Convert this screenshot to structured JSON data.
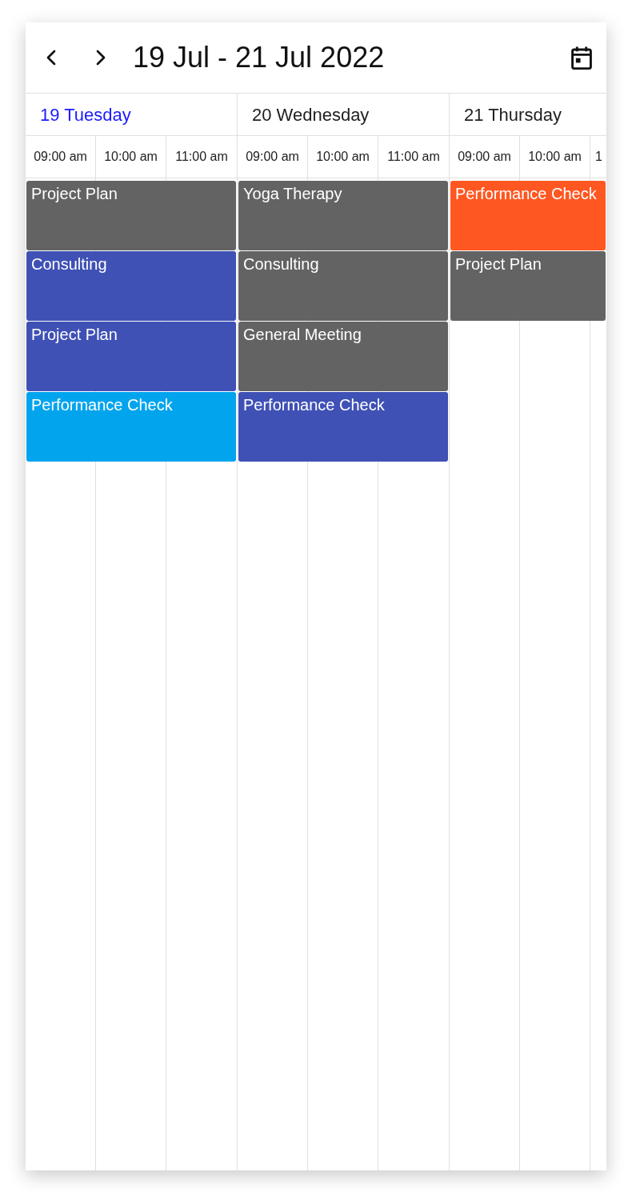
{
  "toolbar": {
    "title": "19 Jul - 21 Jul 2022"
  },
  "days": [
    {
      "label": "19 Tuesday",
      "selected": true,
      "times": [
        "09:00 am",
        "10:00 am",
        "11:00 am"
      ],
      "events": [
        {
          "title": "Project Plan",
          "color": "#636363"
        },
        {
          "title": "Consulting",
          "color": "#3f51b5"
        },
        {
          "title": "Project Plan",
          "color": "#3f51b5"
        },
        {
          "title": "Performance Check",
          "color": "#03a4ee"
        }
      ]
    },
    {
      "label": "20 Wednesday",
      "selected": false,
      "times": [
        "09:00 am",
        "10:00 am",
        "11:00 am"
      ],
      "events": [
        {
          "title": "Yoga Therapy",
          "color": "#636363"
        },
        {
          "title": "Consulting",
          "color": "#636363"
        },
        {
          "title": "General Meeting",
          "color": "#636363"
        },
        {
          "title": "Performance Check",
          "color": "#3f51b5"
        }
      ]
    },
    {
      "label": "21 Thursday",
      "selected": false,
      "times": [
        "09:00 am",
        "10:00 am",
        "1"
      ],
      "events": [
        {
          "title": "Performance Check",
          "color": "#ff5722"
        },
        {
          "title": "Project Plan",
          "color": "#636363"
        }
      ]
    }
  ]
}
